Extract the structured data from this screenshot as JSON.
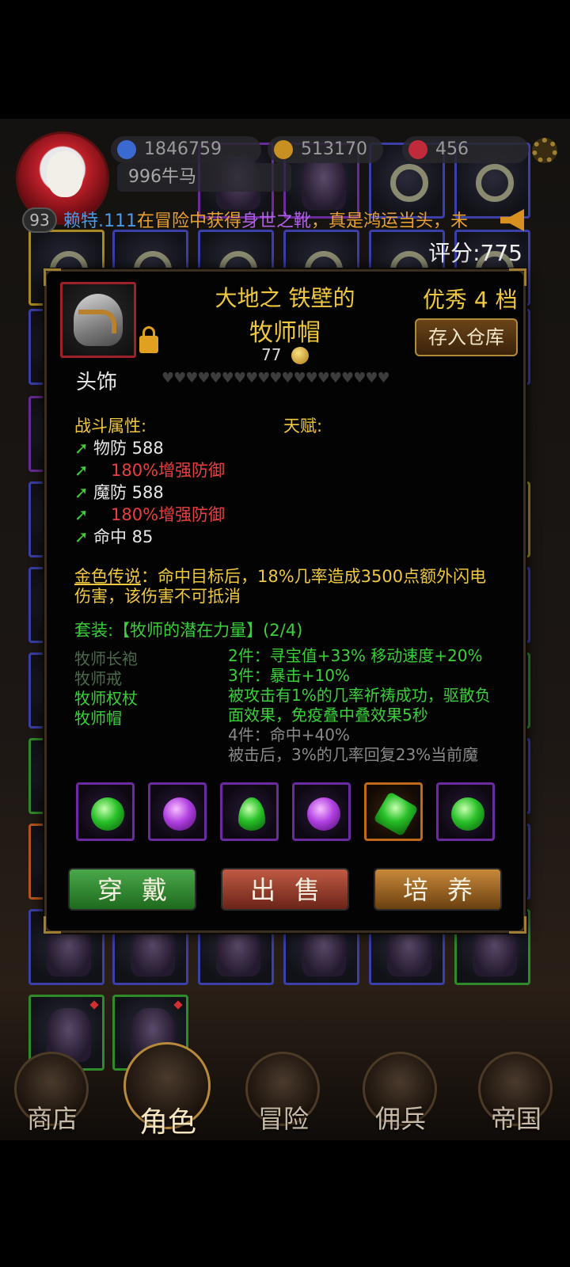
{
  "hud": {
    "currencies": [
      {
        "icon": "blue-gem-icon",
        "value": "1846759",
        "color": "#3a6ad0"
      },
      {
        "icon": "gold-coin-icon",
        "value": "513170",
        "color": "#c89020"
      },
      {
        "icon": "red-gem-icon",
        "value": "456",
        "color": "#c02a3a"
      }
    ],
    "player_name": "996牛马",
    "level": "93",
    "score": "评分:775"
  },
  "ticker": {
    "name": "赖特.111",
    "text1": "在冒险中获得",
    "item": "身世之靴",
    "text2": "，真是鸿运当头，未"
  },
  "item": {
    "name_line1": "大地之 铁壁的",
    "name_line2": "牧师帽",
    "price": "77",
    "grade": "优秀 4 档",
    "store_button": "存入仓库",
    "slot_type": "头饰",
    "hearts": "♥♥♥♥♥♥♥♥♥♥♥♥♥♥♥♥♥♥♥",
    "combat_label": "战斗属性:",
    "talent_label": "天赋:",
    "stats": [
      {
        "text": "物防 588",
        "bonus": false
      },
      {
        "text": "180%增强防御",
        "bonus": true
      },
      {
        "text": "魔防 588",
        "bonus": false
      },
      {
        "text": "180%增强防御",
        "bonus": true
      },
      {
        "text": "命中 85",
        "bonus": false
      }
    ],
    "legend_label": "金色传说",
    "legend_text": "：命中目标后，18%几率造成3500点额外闪电伤害，该伤害不可抵消",
    "set_title": "套装:【牧师的潜在力量】(2/4)",
    "set_pieces": [
      {
        "name": "牧师长袍",
        "owned": false
      },
      {
        "name": "牧师戒",
        "owned": false
      },
      {
        "name": "牧师权杖",
        "owned": true
      },
      {
        "name": "牧师帽",
        "owned": true
      }
    ],
    "set_bonuses": [
      {
        "text": "2件：寻宝值+33% 移动速度+20%",
        "active": true
      },
      {
        "text": "3件：暴击+10%",
        "active": true
      },
      {
        "text": "被攻击有1%的几率祈祷成功，驱散负面效果，免疫叠中叠效果5秒",
        "active": true
      },
      {
        "text": "4件：命中+40%",
        "active": false
      },
      {
        "text": "被击后，3%的几率回复23%当前魔",
        "active": false
      }
    ],
    "gems": [
      "green",
      "purple",
      "green-drop",
      "purple",
      "green-hex",
      "green"
    ]
  },
  "actions": {
    "equip": "穿戴",
    "sell": "出售",
    "train": "培养"
  },
  "nav": [
    {
      "label": "商店",
      "icon": "shop-castle-icon"
    },
    {
      "label": "角色",
      "icon": "character-hood-icon",
      "active": true
    },
    {
      "label": "冒险",
      "icon": "crossed-swords-icon"
    },
    {
      "label": "佣兵",
      "icon": "mercenary-card-icon"
    },
    {
      "label": "帝国",
      "icon": "crown-icon"
    }
  ]
}
